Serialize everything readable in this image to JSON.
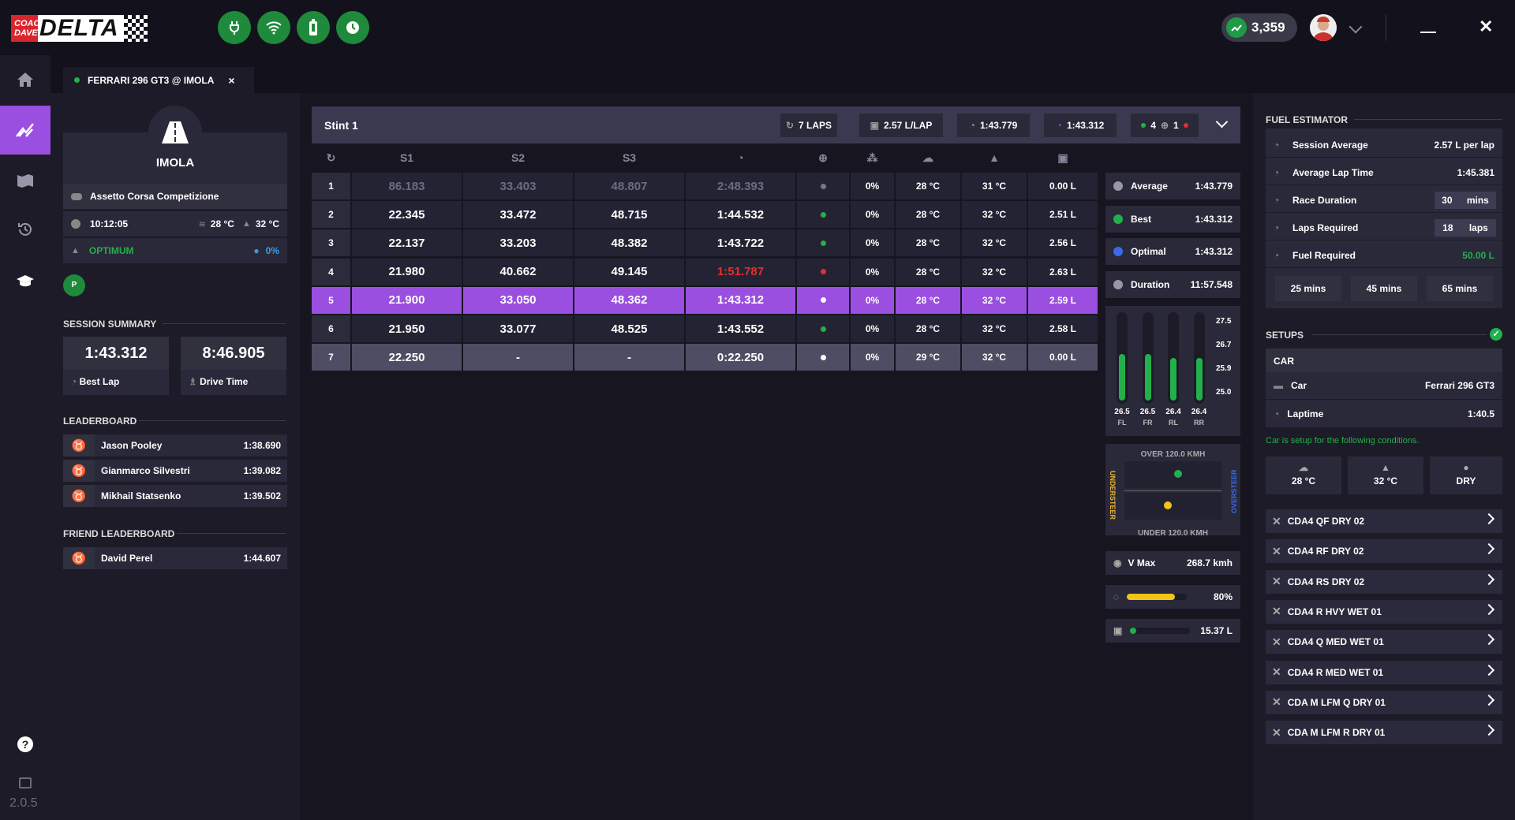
{
  "app": {
    "logo_coach": "COACH",
    "logo_dave": "DAVE",
    "logo_delta": "DELTA",
    "version": "2.0.5"
  },
  "topbar": {
    "score": "3,359"
  },
  "tab": {
    "label": "FERRARI 296 GT3 @ IMOLA",
    "close": "×"
  },
  "track": {
    "name": "IMOLA",
    "game": "Assetto Corsa Competizione",
    "time": "10:12:05",
    "air_temp": "28 °C",
    "track_temp": "32 °C",
    "grip": "OPTIMUM",
    "wetness": "0%",
    "session_badge": "P"
  },
  "session_summary": {
    "title": "SESSION SUMMARY",
    "best_lap": "1:43.312",
    "best_lap_label": "Best Lap",
    "drive_time": "8:46.905",
    "drive_time_label": "Drive Time"
  },
  "leaderboard": {
    "title": "LEADERBOARD",
    "rows": [
      {
        "name": "Jason Pooley",
        "time": "1:38.690",
        "medal": "#f0b429"
      },
      {
        "name": "Gianmarco Silvestri",
        "time": "1:39.082",
        "medal": "#b8bcc8"
      },
      {
        "name": "Mikhail Statsenko",
        "time": "1:39.502",
        "medal": "#d9823b"
      }
    ]
  },
  "friend_leaderboard": {
    "title": "FRIEND LEADERBOARD",
    "rows": [
      {
        "name": "David Perel",
        "time": "1:44.607",
        "medal": "#f0b429"
      }
    ]
  },
  "stint": {
    "title": "Stint 1",
    "laps": "7 LAPS",
    "fuel_per_lap": "2.57 L/LAP",
    "avg_time": "1:43.779",
    "best_time": "1:43.312",
    "green_count": "4",
    "red_count": "1"
  },
  "table": {
    "headers": [
      "S1",
      "S2",
      "S3"
    ],
    "rows": [
      {
        "lap": "1",
        "s1": "86.183",
        "s2": "33.403",
        "s3": "48.807",
        "time": "2:48.393",
        "valid": "grey",
        "rain": "0%",
        "air": "28 °C",
        "track": "31 °C",
        "fuel": "0.00 L",
        "style": "dim"
      },
      {
        "lap": "2",
        "s1": "22.345",
        "s2": "33.472",
        "s3": "48.715",
        "time": "1:44.532",
        "valid": "green",
        "rain": "0%",
        "air": "28 °C",
        "track": "32 °C",
        "fuel": "2.51 L",
        "style": "normal"
      },
      {
        "lap": "3",
        "s1": "22.137",
        "s2": "33.203",
        "s3": "48.382",
        "time": "1:43.722",
        "valid": "green",
        "rain": "0%",
        "air": "28 °C",
        "track": "32 °C",
        "fuel": "2.56 L",
        "style": "normal"
      },
      {
        "lap": "4",
        "s1": "21.980",
        "s2": "40.662",
        "s3": "49.145",
        "time": "1:51.787",
        "valid": "red",
        "rain": "0%",
        "air": "28 °C",
        "track": "32 °C",
        "fuel": "2.63 L",
        "style": "invalid"
      },
      {
        "lap": "5",
        "s1": "21.900",
        "s2": "33.050",
        "s3": "48.362",
        "time": "1:43.312",
        "valid": "white",
        "rain": "0%",
        "air": "28 °C",
        "track": "32 °C",
        "fuel": "2.59 L",
        "style": "best"
      },
      {
        "lap": "6",
        "s1": "21.950",
        "s2": "33.077",
        "s3": "48.525",
        "time": "1:43.552",
        "valid": "green",
        "rain": "0%",
        "air": "28 °C",
        "track": "32 °C",
        "fuel": "2.58 L",
        "style": "normal"
      },
      {
        "lap": "7",
        "s1": "22.250",
        "s2": "-",
        "s3": "-",
        "time": "0:22.250",
        "valid": "white",
        "rain": "0%",
        "air": "29 °C",
        "track": "32 °C",
        "fuel": "0.00 L",
        "style": "current"
      }
    ]
  },
  "stats": {
    "average_label": "Average",
    "average": "1:43.779",
    "best_label": "Best",
    "best": "1:43.312",
    "optimal_label": "Optimal",
    "optimal": "1:43.312",
    "duration_label": "Duration",
    "duration": "11:57.548"
  },
  "tyres": {
    "scale": [
      "27.5",
      "26.7",
      "25.9",
      "25.0"
    ],
    "values": [
      "26.5",
      "26.5",
      "26.4",
      "26.4"
    ],
    "labels": [
      "FL",
      "FR",
      "RL",
      "RR"
    ],
    "levels": [
      0.55,
      0.55,
      0.5,
      0.5
    ]
  },
  "balance": {
    "over_label": "OVER 120.0 KMH",
    "under_label": "UNDER 120.0 KMH",
    "left_label": "UNDERSTEER",
    "right_label": "OVERSTEER",
    "fast_pos": 0.55,
    "slow_pos": 0.45
  },
  "vmax": {
    "label": "V Max",
    "value": "268.7 kmh"
  },
  "throttle": {
    "value": "80%",
    "level": 0.8
  },
  "fuel_gauge": {
    "value": "15.37 L",
    "level": 0.1
  },
  "fuel_estimator": {
    "title": "FUEL ESTIMATOR",
    "session_avg_label": "Session Average",
    "session_avg": "2.57 L per lap",
    "avg_lap_label": "Average Lap Time",
    "avg_lap": "1:45.381",
    "race_duration_label": "Race Duration",
    "race_duration": "30",
    "race_duration_unit": "mins",
    "laps_required_label": "Laps Required",
    "laps_required": "18",
    "laps_unit": "laps",
    "fuel_required_label": "Fuel Required",
    "fuel_required": "50.00 L",
    "presets": [
      "25 mins",
      "45 mins",
      "65 mins"
    ]
  },
  "setups": {
    "title": "SETUPS",
    "car_header": "CAR",
    "car_label": "Car",
    "car_value": "Ferrari 296 GT3",
    "laptime_label": "Laptime",
    "laptime_value": "1:40.5",
    "note": "Car is setup for the following conditions.",
    "cond_air": "28 °C",
    "cond_track": "32 °C",
    "cond_state": "DRY",
    "items": [
      "CDA4 QF DRY 02",
      "CDA4 RF DRY 02",
      "CDA4 RS DRY 02",
      "CDA4 R HVY WET 01",
      "CDA4 Q MED WET 01",
      "CDA4 R MED WET 01",
      "CDA M LFM Q DRY 01",
      "CDA M LFM R DRY 01"
    ]
  },
  "colors": {
    "accent": "#9a4fe0",
    "green": "#22b04b",
    "red": "#e0302f",
    "panel": "#2a2939"
  }
}
